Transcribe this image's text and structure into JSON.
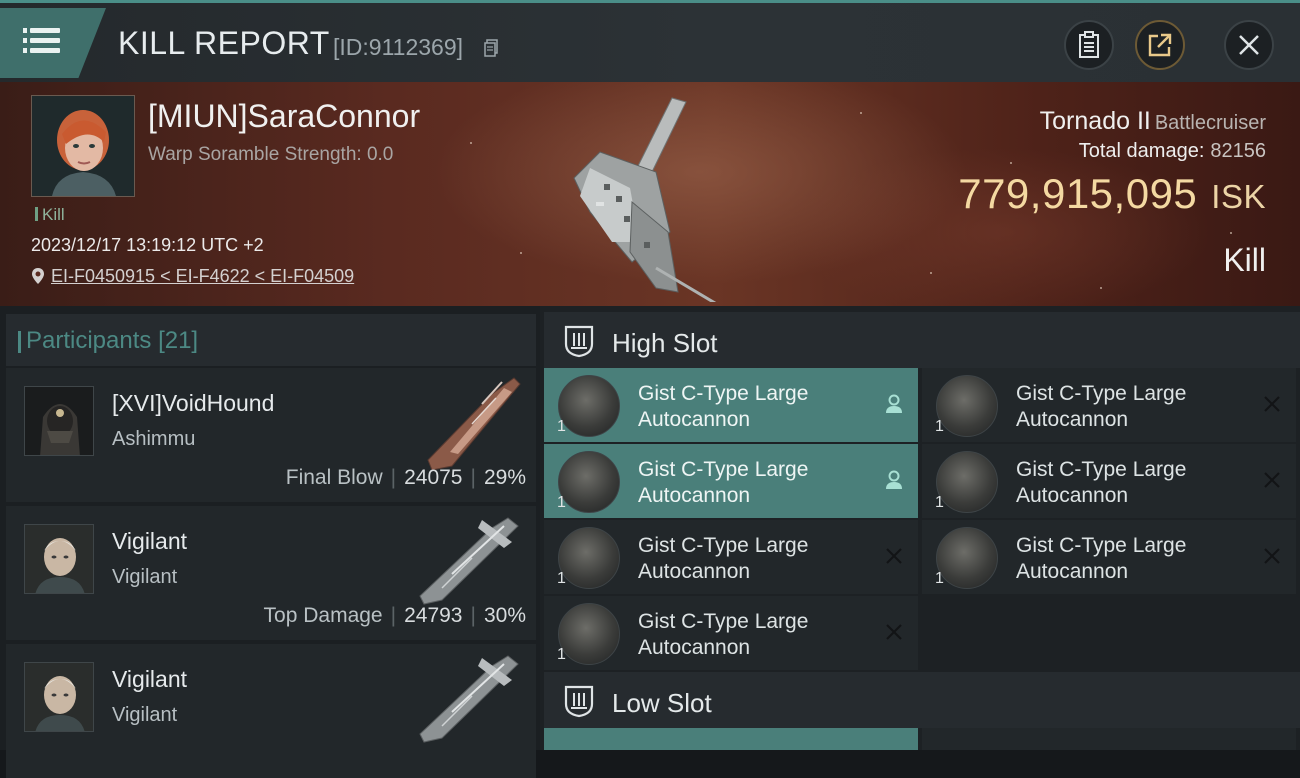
{
  "header": {
    "title": "KILL REPORT",
    "report_id": "[ID:9112369]"
  },
  "victim": {
    "name": "[MIUN]SaraConnor",
    "scramble": "Warp Soramble Strength: 0.0",
    "tag": "Kill",
    "datetime": "2023/12/17 13:19:12 UTC +2",
    "location": "EI-F0450915 < EI-F4622 < EI-F04509",
    "ship_name": "Tornado II",
    "ship_class": "Battlecruiser",
    "total_damage_label": "Total damage:",
    "total_damage": "82156",
    "isk_value": "779,915,095",
    "isk_unit": "ISK",
    "kill_type": "Kill"
  },
  "participants": {
    "label": "Participants",
    "count": "[21]",
    "items": [
      {
        "name": "[XVI]VoidHound",
        "ship": "Ashimmu",
        "role": "Final Blow",
        "damage": "24075",
        "percent": "29%"
      },
      {
        "name": "Vigilant",
        "ship": "Vigilant",
        "role": "Top Damage",
        "damage": "24793",
        "percent": "30%"
      },
      {
        "name": "Vigilant",
        "ship": "Vigilant",
        "role": "",
        "damage": "",
        "percent": ""
      }
    ]
  },
  "fitting": {
    "high_slot_label": "High Slot",
    "low_slot_label": "Low Slot",
    "modules": [
      {
        "line1": "Gist C-Type Large",
        "line2": "Autocannon",
        "qty": "1",
        "status": "user-icon"
      },
      {
        "line1": "Gist C-Type Large",
        "line2": "Autocannon",
        "qty": "1",
        "status": "x-icon"
      },
      {
        "line1": "Gist C-Type Large",
        "line2": "Autocannon",
        "qty": "1",
        "status": "user-icon"
      },
      {
        "line1": "Gist C-Type Large",
        "line2": "Autocannon",
        "qty": "1",
        "status": "x-icon"
      },
      {
        "line1": "Gist C-Type Large",
        "line2": "Autocannon",
        "qty": "1",
        "status": "x-icon"
      },
      {
        "line1": "Gist C-Type Large",
        "line2": "Autocannon",
        "qty": "1",
        "status": "x-icon"
      },
      {
        "line1": "Gist C-Type Large",
        "line2": "Autocannon",
        "qty": "1",
        "status": "x-icon"
      }
    ]
  },
  "colors": {
    "accent": "#4a8e88",
    "highlight": "#4a7f7a",
    "isk": "#f4d9a2"
  }
}
